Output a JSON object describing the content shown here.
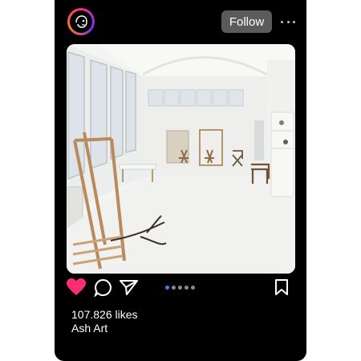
{
  "post": {
    "follow_label": "Follow",
    "likes": "107.826 likes",
    "author": "Ash Art",
    "carousel": {
      "count": 5,
      "active": 1
    }
  },
  "icons": {
    "avatar": "face-logo-icon",
    "more": "more-horizontal-icon",
    "like": "heart-filled-icon",
    "comment": "comment-bubble-icon",
    "share": "send-paper-plane-icon",
    "save": "bookmark-icon"
  },
  "colors": {
    "card_bg": "#000000",
    "follow_bg": "#5b5b5b",
    "like": "#ff2d73",
    "active_dot": "#3b82f6"
  }
}
